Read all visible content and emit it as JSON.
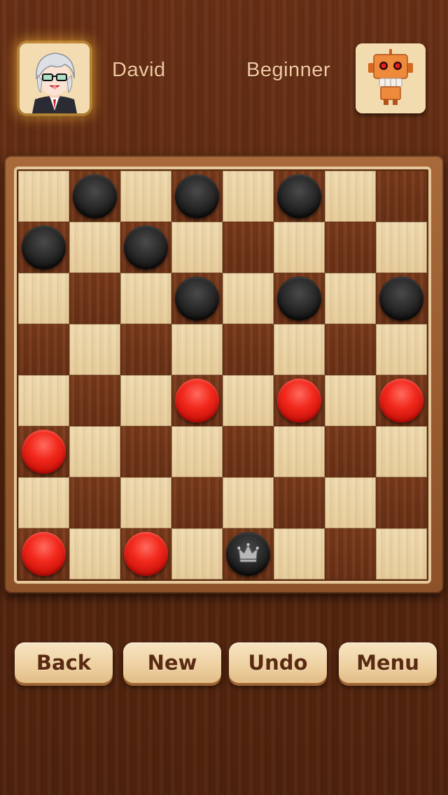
{
  "players": {
    "human": {
      "name": "David",
      "avatar": "human-avatar"
    },
    "ai": {
      "name": "Beginner",
      "avatar": "robot-avatar"
    }
  },
  "board": {
    "size": 8,
    "pieces": [
      {
        "row": 0,
        "col": 1,
        "color": "black",
        "king": false
      },
      {
        "row": 0,
        "col": 3,
        "color": "black",
        "king": false
      },
      {
        "row": 0,
        "col": 5,
        "color": "black",
        "king": false
      },
      {
        "row": 1,
        "col": 0,
        "color": "black",
        "king": false
      },
      {
        "row": 1,
        "col": 2,
        "color": "black",
        "king": false
      },
      {
        "row": 2,
        "col": 3,
        "color": "black",
        "king": false
      },
      {
        "row": 2,
        "col": 5,
        "color": "black",
        "king": false
      },
      {
        "row": 2,
        "col": 7,
        "color": "black",
        "king": false
      },
      {
        "row": 4,
        "col": 3,
        "color": "red",
        "king": false
      },
      {
        "row": 4,
        "col": 5,
        "color": "red",
        "king": false
      },
      {
        "row": 4,
        "col": 7,
        "color": "red",
        "king": false
      },
      {
        "row": 5,
        "col": 0,
        "color": "red",
        "king": false
      },
      {
        "row": 7,
        "col": 0,
        "color": "red",
        "king": false
      },
      {
        "row": 7,
        "col": 2,
        "color": "red",
        "king": false
      },
      {
        "row": 7,
        "col": 4,
        "color": "black",
        "king": true
      }
    ]
  },
  "buttons": {
    "back": "Back",
    "new": "New",
    "undo": "Undo",
    "menu": "Menu"
  },
  "colors": {
    "red_piece": "#e8221a",
    "black_piece": "#1c1c1c",
    "light_square": "#ecd6aa",
    "dark_square": "#733618",
    "button_text": "#5a2a12",
    "name_text": "#f1c9a0"
  }
}
